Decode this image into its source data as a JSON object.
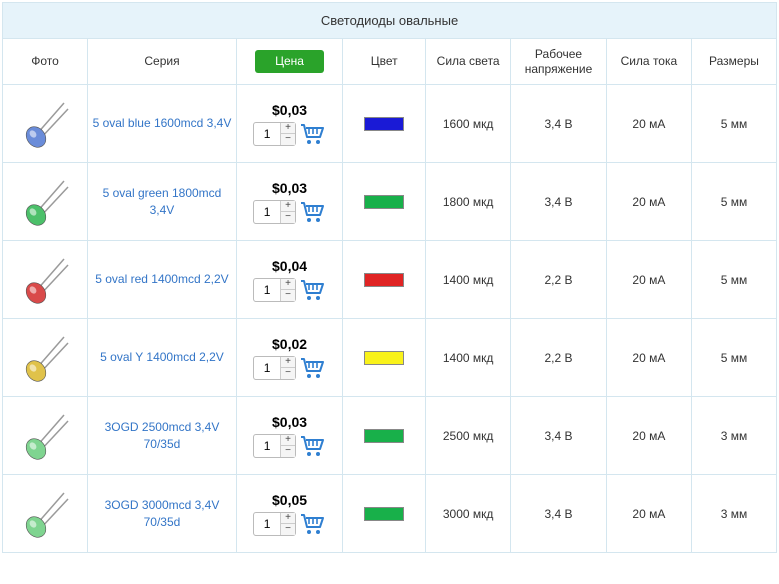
{
  "title": "Светодиоды овальные",
  "headers": {
    "photo": "Фото",
    "series": "Серия",
    "price": "Цена",
    "color": "Цвет",
    "luminous": "Сила света",
    "voltage": "Рабочее напряжение",
    "current": "Сила тока",
    "size": "Размеры"
  },
  "qty_default": "1",
  "qty_plus": "+",
  "qty_minus": "−",
  "rows": [
    {
      "series": "5 oval blue 1600mcd 3,4V",
      "price": "$0,03",
      "color": "#1a1ad6",
      "luminous": "1600 мкд",
      "voltage": "3,4 В",
      "current": "20 мА",
      "size": "5 мм",
      "led_color": "#6a8cd9"
    },
    {
      "series": "5 oval green 1800mcd 3,4V",
      "price": "$0,03",
      "color": "#18b04a",
      "luminous": "1800 мкд",
      "voltage": "3,4 В",
      "current": "20 мА",
      "size": "5 мм",
      "led_color": "#4cc06a"
    },
    {
      "series": "5 oval red 1400mcd 2,2V",
      "price": "$0,04",
      "color": "#e02424",
      "luminous": "1400 мкд",
      "voltage": "2,2 В",
      "current": "20 мА",
      "size": "5 мм",
      "led_color": "#d94a4a"
    },
    {
      "series": "5 oval Y 1400mcd 2,2V",
      "price": "$0,02",
      "color": "#f9f21a",
      "luminous": "1400 мкд",
      "voltage": "2,2 В",
      "current": "20 мА",
      "size": "5 мм",
      "led_color": "#e0c24a"
    },
    {
      "series": "3OGD 2500mcd 3,4V 70/35d",
      "price": "$0,03",
      "color": "#18b04a",
      "luminous": "2500 мкд",
      "voltage": "3,4 В",
      "current": "20 мА",
      "size": "3 мм",
      "led_color": "#7fd490"
    },
    {
      "series": "3OGD 3000mcd 3,4V 70/35d",
      "price": "$0,05",
      "color": "#18b04a",
      "luminous": "3000 мкд",
      "voltage": "3,4 В",
      "current": "20 мА",
      "size": "3 мм",
      "led_color": "#7fd490"
    }
  ]
}
